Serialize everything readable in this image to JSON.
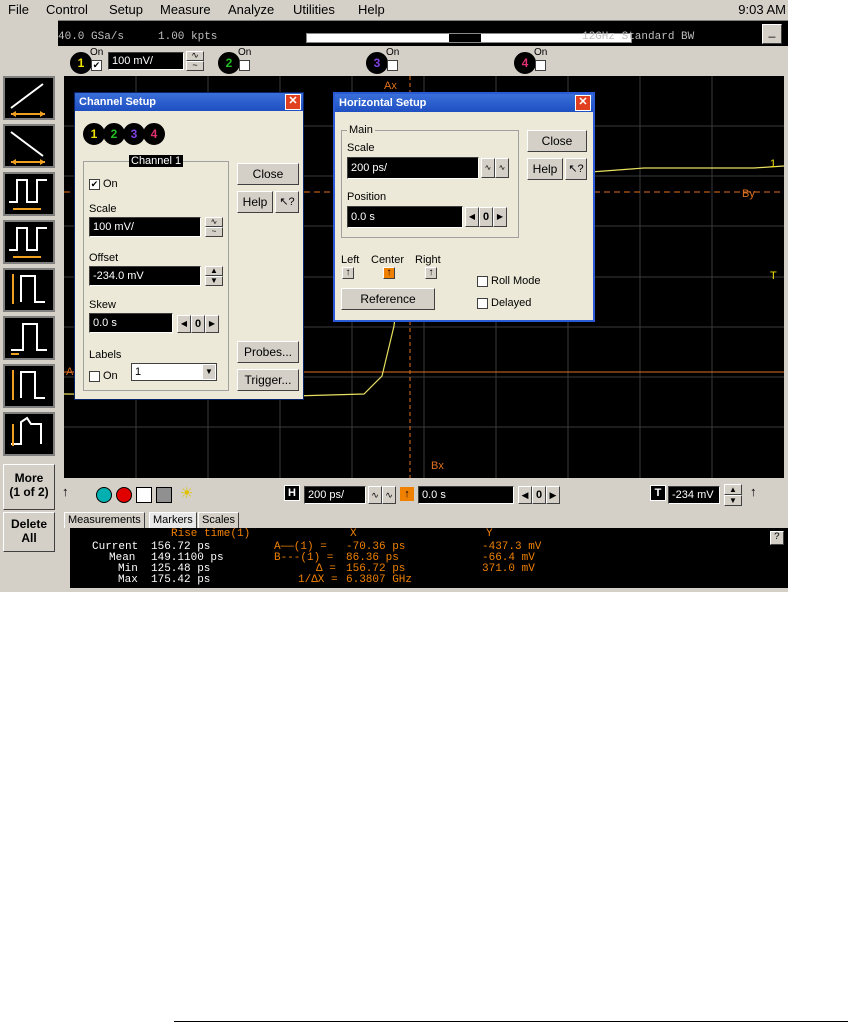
{
  "menu": [
    "File",
    "Control",
    "Setup",
    "Measure",
    "Analyze",
    "Utilities",
    "Help"
  ],
  "clock": "9:03 AM",
  "top_status": {
    "sample_rate": "40.0 GSa/s",
    "points": "1.00 kpts",
    "bandwidth": "12GHz Standard BW",
    "minimize": "_"
  },
  "channels": [
    {
      "num": "1",
      "on_label": "On",
      "on": true,
      "scale": "100 mV/",
      "color": "#f0e000"
    },
    {
      "num": "2",
      "on_label": "On",
      "on": false,
      "color": "#20c020"
    },
    {
      "num": "3",
      "on_label": "On",
      "on": false,
      "color": "#8040e0"
    },
    {
      "num": "4",
      "on_label": "On",
      "on": false,
      "color": "#e03070"
    }
  ],
  "left_toolbar": {
    "more": "More\n(1 of 2)",
    "more_l1": "More",
    "more_l2": "(1 of 2)",
    "delete_l1": "Delete",
    "delete_l2": "All"
  },
  "markers": {
    "ax": "Ax",
    "bx": "Bx",
    "by": "By",
    "a": "A",
    "t": "T",
    "ch1": "1"
  },
  "bottom_bar": {
    "h_label": "H",
    "h_scale": "200 ps/",
    "position": "0.0 s",
    "zero": "0",
    "t_label": "T",
    "trigger_level": "-234 mV"
  },
  "tabs": [
    "Measurements",
    "Markers",
    "Scales"
  ],
  "measurements": {
    "title": "Rise time(1)",
    "rows": [
      {
        "label": "Current",
        "value": "156.72 ps"
      },
      {
        "label": "Mean",
        "value": "149.1100 ps"
      },
      {
        "label": "Min",
        "value": "125.48 ps"
      },
      {
        "label": "Max",
        "value": "175.42 ps"
      }
    ],
    "x_header": "X",
    "y_header": "Y",
    "markers": [
      {
        "label": "A——(1) =",
        "x": "-70.36 ps",
        "y": "-437.3 mV"
      },
      {
        "label": "B---(1) =",
        "x": "86.36 ps",
        "y": "-66.4 mV"
      },
      {
        "label": "Δ =",
        "x": "156.72 ps",
        "y": "371.0 mV"
      },
      {
        "label": "1/ΔX =",
        "x": "6.3807 GHz",
        "y": ""
      }
    ],
    "help": "?"
  },
  "channel_setup": {
    "title": "Channel Setup",
    "group": "Channel 1",
    "on_label": "On",
    "scale_label": "Scale",
    "scale": "100 mV/",
    "offset_label": "Offset",
    "offset": "-234.0 mV",
    "skew_label": "Skew",
    "skew": "0.0 s",
    "zero": "0",
    "labels_label": "Labels",
    "labels_on": "On",
    "labels_value": "1",
    "close": "Close",
    "help": "Help",
    "probes": "Probes...",
    "trigger": "Trigger..."
  },
  "horizontal_setup": {
    "title": "Horizontal Setup",
    "group": "Main",
    "scale_label": "Scale",
    "scale": "200 ps/",
    "position_label": "Position",
    "position": "0.0 s",
    "zero": "0",
    "left": "Left",
    "center": "Center",
    "right": "Right",
    "reference": "Reference",
    "roll_mode": "Roll Mode",
    "delayed": "Delayed",
    "close": "Close",
    "help": "Help"
  }
}
